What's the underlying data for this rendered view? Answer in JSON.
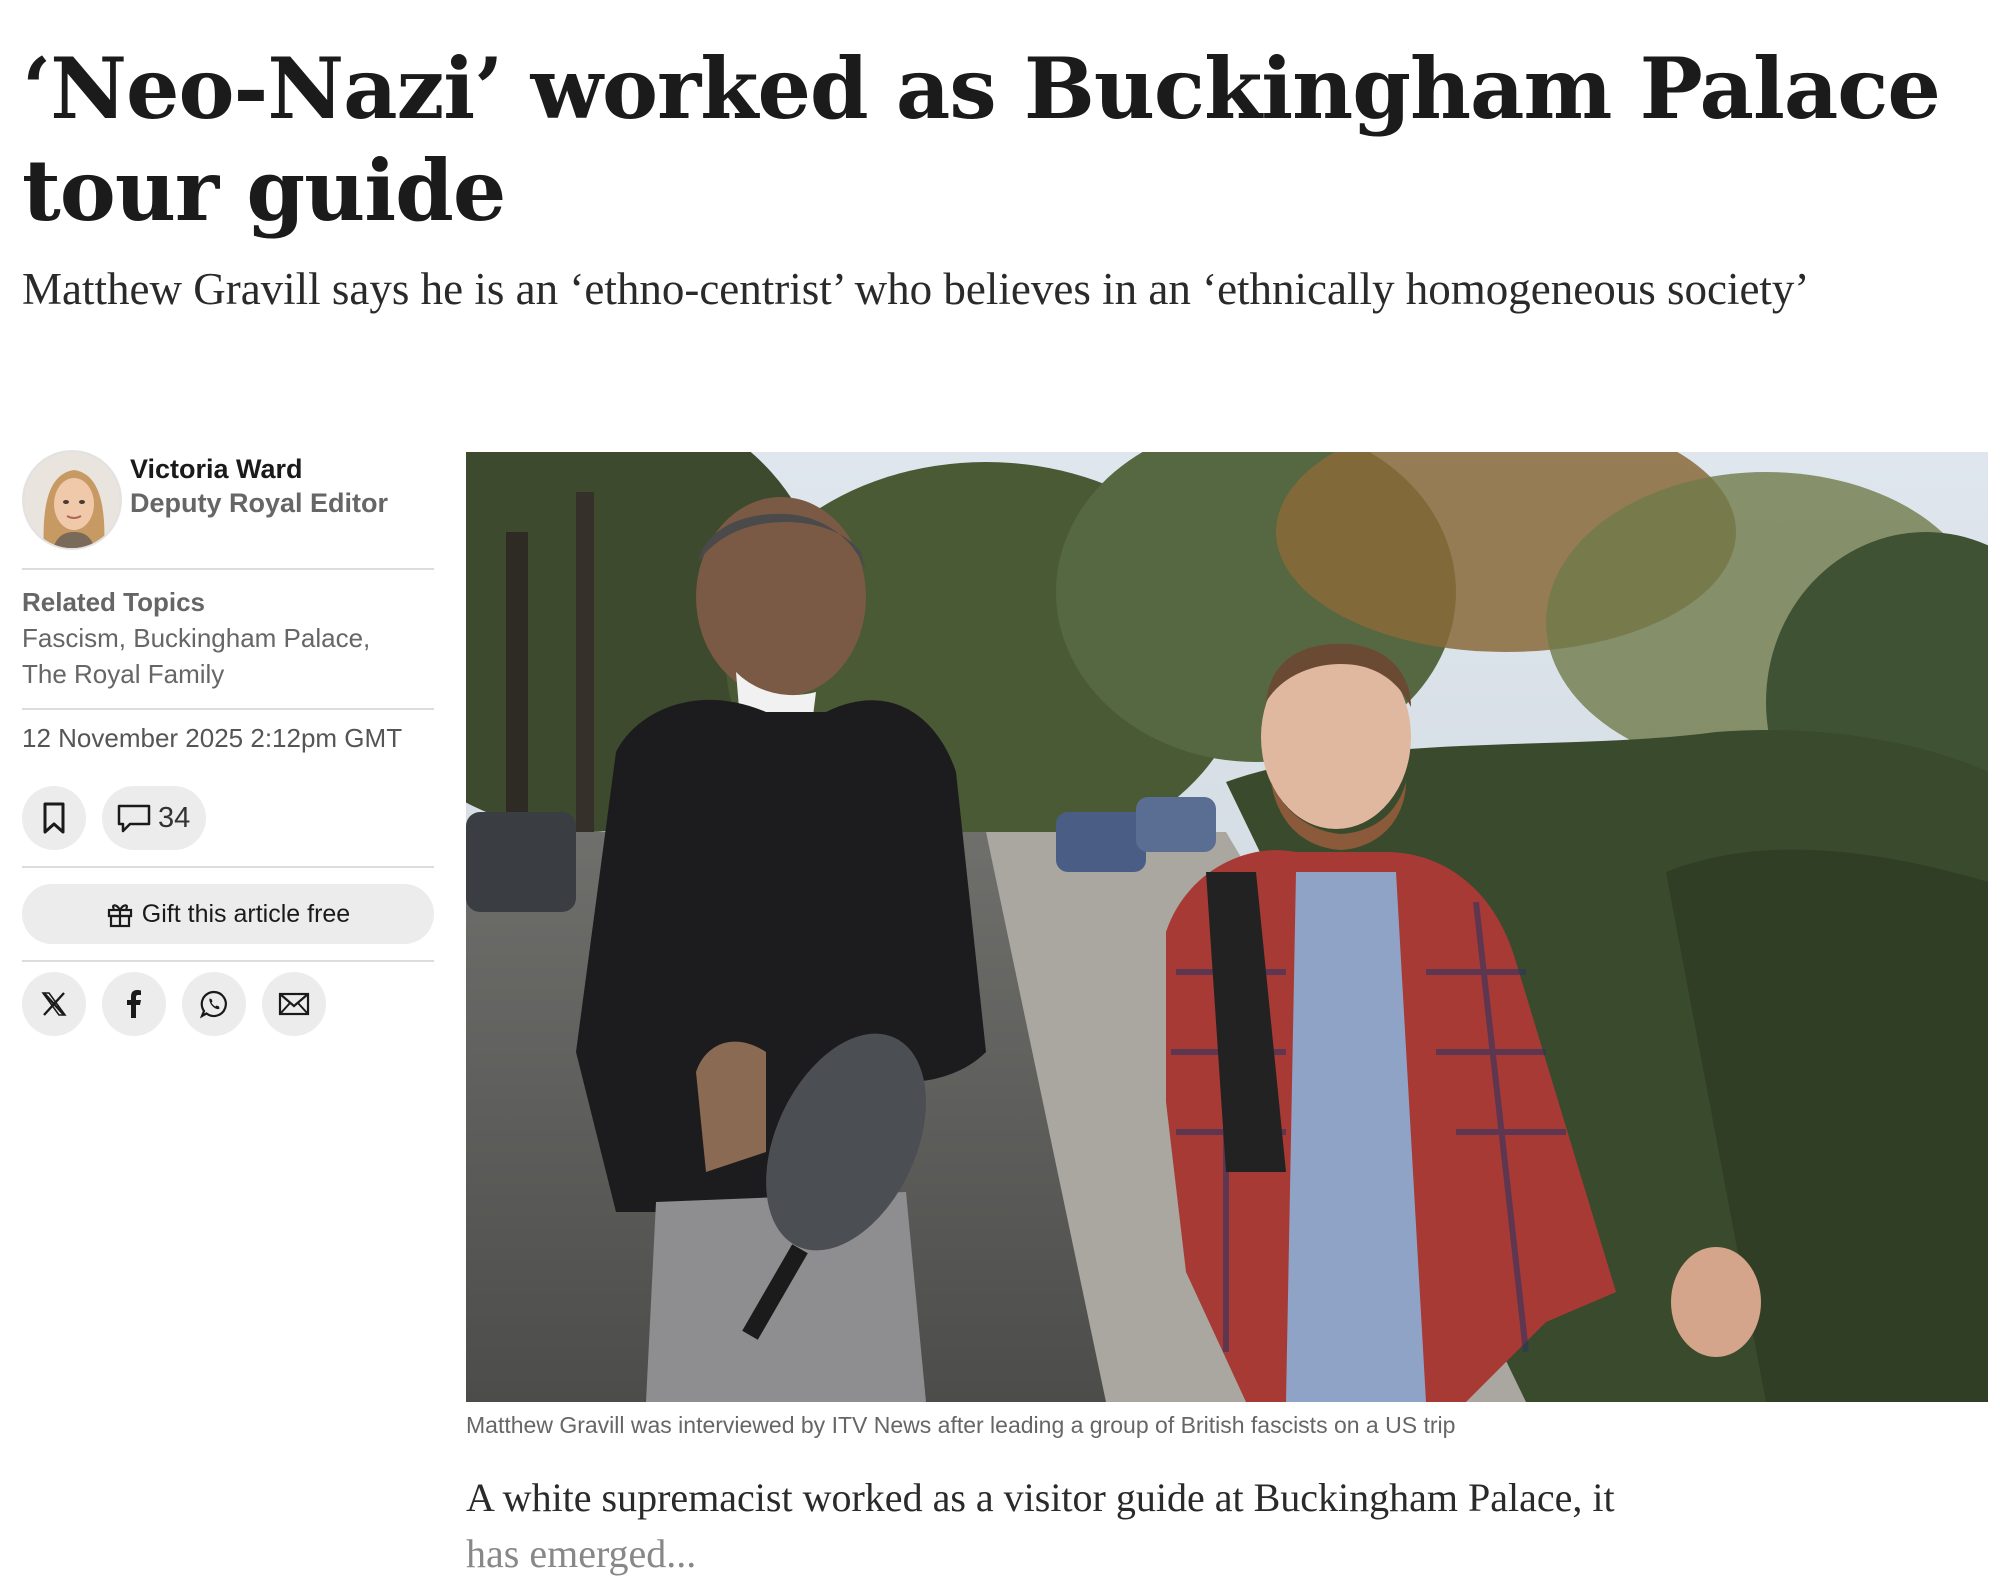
{
  "article": {
    "headline": "‘Neo-Nazi’ worked as Buckingham Palace tour guide",
    "standfirst": "Matthew Gravill says he is an ‘ethno-centrist’ who believes in an ‘ethnically homogeneous society’",
    "intro_line1": "A white supremacist worked as a visitor guide at Buckingham Palace, it",
    "intro_line2": "has emerged..."
  },
  "author": {
    "name": "Victoria Ward",
    "role": "Deputy Royal Editor"
  },
  "topics": {
    "label": "Related Topics",
    "items": [
      "Fascism",
      "Buckingham Palace",
      "The Royal Family"
    ]
  },
  "meta": {
    "date": "12 November 2025 2:12pm GMT",
    "comment_count": "34"
  },
  "actions": {
    "gift_label": "Gift this article free"
  },
  "icons": {
    "bookmark": "bookmark-icon",
    "comments": "comment-icon",
    "gift": "gift-icon",
    "x": "x-icon",
    "facebook": "facebook-icon",
    "whatsapp": "whatsapp-icon",
    "email": "email-icon"
  },
  "image": {
    "caption": "Matthew Gravill was interviewed by ITV News after leading a group of British fascists on a US trip"
  },
  "colors": {
    "text": "#1b1b1b",
    "muted": "#666666",
    "button_bg": "#ececec",
    "divider": "#dcdcdc"
  }
}
